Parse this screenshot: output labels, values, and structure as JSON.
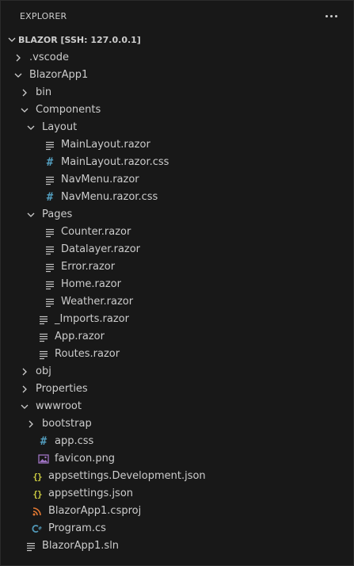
{
  "panel": {
    "title": "EXPLORER",
    "more_label": "..."
  },
  "section": {
    "title": "BLAZOR [SSH: 127.0.0.1]"
  },
  "tree": [
    {
      "label": ".vscode",
      "type": "folder",
      "expanded": false,
      "depth": 1
    },
    {
      "label": "BlazorApp1",
      "type": "folder",
      "expanded": true,
      "depth": 1
    },
    {
      "label": "bin",
      "type": "folder",
      "expanded": false,
      "depth": 2
    },
    {
      "label": "Components",
      "type": "folder",
      "expanded": true,
      "depth": 2
    },
    {
      "label": "Layout",
      "type": "folder",
      "expanded": true,
      "depth": 3
    },
    {
      "label": "MainLayout.razor",
      "type": "razor",
      "depth": 4
    },
    {
      "label": "MainLayout.razor.css",
      "type": "css",
      "depth": 4
    },
    {
      "label": "NavMenu.razor",
      "type": "razor",
      "depth": 4
    },
    {
      "label": "NavMenu.razor.css",
      "type": "css",
      "depth": 4
    },
    {
      "label": "Pages",
      "type": "folder",
      "expanded": true,
      "depth": 3
    },
    {
      "label": "Counter.razor",
      "type": "razor",
      "depth": 4
    },
    {
      "label": "Datalayer.razor",
      "type": "razor",
      "depth": 4
    },
    {
      "label": "Error.razor",
      "type": "razor",
      "depth": 4
    },
    {
      "label": "Home.razor",
      "type": "razor",
      "depth": 4
    },
    {
      "label": "Weather.razor",
      "type": "razor",
      "depth": 4
    },
    {
      "label": "_Imports.razor",
      "type": "razor",
      "depth": 3
    },
    {
      "label": "App.razor",
      "type": "razor",
      "depth": 3
    },
    {
      "label": "Routes.razor",
      "type": "razor",
      "depth": 3
    },
    {
      "label": "obj",
      "type": "folder",
      "expanded": false,
      "depth": 2
    },
    {
      "label": "Properties",
      "type": "folder",
      "expanded": false,
      "depth": 2
    },
    {
      "label": "wwwroot",
      "type": "folder",
      "expanded": true,
      "depth": 2
    },
    {
      "label": "bootstrap",
      "type": "folder",
      "expanded": false,
      "depth": 3
    },
    {
      "label": "app.css",
      "type": "css",
      "depth": 3
    },
    {
      "label": "favicon.png",
      "type": "image",
      "depth": 3
    },
    {
      "label": "appsettings.Development.json",
      "type": "json",
      "depth": 2
    },
    {
      "label": "appsettings.json",
      "type": "json",
      "depth": 2
    },
    {
      "label": "BlazorApp1.csproj",
      "type": "rss",
      "depth": 2
    },
    {
      "label": "Program.cs",
      "type": "csharp",
      "depth": 2
    },
    {
      "label": "BlazorApp1.sln",
      "type": "razor",
      "depth": 1
    }
  ],
  "icon_names": {
    "folder_collapsed": "chevron-right-icon",
    "folder_expanded": "chevron-down-icon",
    "razor": "lines-file-icon",
    "css": "hash-css-icon",
    "json": "braces-json-icon",
    "image": "image-file-icon",
    "rss": "rss-feed-icon",
    "csharp": "csharp-icon"
  },
  "colors": {
    "background": "#181818",
    "text": "#cccccc",
    "css_icon": "#519aba",
    "json_icon": "#cbcb41",
    "image_icon": "#a074c4",
    "rss_icon": "#e37933",
    "csharp_icon": "#519aba"
  }
}
